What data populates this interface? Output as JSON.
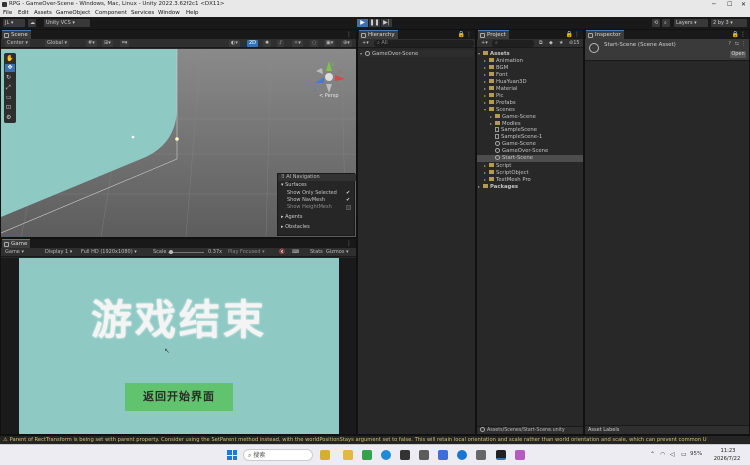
{
  "window": {
    "title": "RPG - GameOver-Scene - Windows, Mac, Linux - Unity 2022.3.62f2c1 <DX11>"
  },
  "menu": [
    "File",
    "Edit",
    "Assets",
    "GameObject",
    "Component",
    "Services",
    "Window",
    "Help"
  ],
  "toolbar": {
    "account": "JL",
    "vcs": "Unity VCS",
    "layers": "Layers",
    "layout": "2 by 3"
  },
  "scene": {
    "tab": "Scene",
    "toolbar": {
      "pivot": "Center",
      "space": "Global",
      "mode_2d": "2D"
    },
    "persp_label": "< Persp",
    "gizmo_axes": [
      "x",
      "y",
      "z"
    ],
    "ai_nav": {
      "title": "AI Navigation",
      "surfaces": "Surfaces",
      "options": [
        {
          "label": "Show Only Selected",
          "checked": true
        },
        {
          "label": "Show NavMesh",
          "checked": true
        },
        {
          "label": "Show HeightMesh",
          "checked": false
        }
      ],
      "agents": "Agents",
      "obstacles": "Obstacles"
    }
  },
  "game": {
    "tab": "Game",
    "view_mode": "Game",
    "display": "Display 1",
    "resolution": "Full HD (1920x1080)",
    "scale_label": "Scale",
    "scale_value": "0.37x",
    "play_focused": "Play Focused",
    "stats": "Stats",
    "gizmos": "Gizmos",
    "heading": "游戏结束",
    "button": "返回开始界面"
  },
  "hierarchy": {
    "tab": "Hierarchy",
    "search": "All",
    "root": "GameOver-Scene"
  },
  "project": {
    "tab": "Project",
    "count": "15",
    "assets_root": "Assets",
    "folders": [
      "Animation",
      "BGM",
      "Font",
      "HuaYuan3D",
      "Material",
      "Pic",
      "Prefabs"
    ],
    "scenes_folder": "Scenes",
    "scene_items": [
      {
        "name": "Game-Scene",
        "kind": "folder"
      },
      {
        "name": "Modles",
        "kind": "folder"
      },
      {
        "name": "SampleScene",
        "kind": "doc"
      },
      {
        "name": "SampleScene-1",
        "kind": "doc"
      },
      {
        "name": "Game-Scene",
        "kind": "scene"
      },
      {
        "name": "GameOver-Scene",
        "kind": "scene"
      },
      {
        "name": "Start-Scene",
        "kind": "scene"
      }
    ],
    "after_folders": [
      "Script",
      "ScriptObject",
      "TextMesh Pro"
    ],
    "packages": "Packages",
    "footer_path": "Assets/Scenes/Start-Scene.unity"
  },
  "inspector": {
    "tab": "Inspector",
    "object_name": "Start-Scene (Scene Asset)",
    "open_button": "Open",
    "asset_labels": "Asset Labels"
  },
  "status": {
    "message": "Parent of RectTransform is being set with parent property. Consider using the SetParent method instead, with the worldPositionStays argument set to false. This will retain local orientation and scale rather than world orientation and scale, which can prevent common U"
  },
  "taskbar": {
    "search_placeholder": "搜索",
    "battery": "95%",
    "time": "11:23",
    "date": "2026/7/22"
  },
  "colors": {
    "game_bg": "#8fc9c4",
    "heading": "#f4f4f4",
    "button_bg": "#62c36e",
    "button_text": "#2b2b2b",
    "selection": "#3a72b0"
  }
}
